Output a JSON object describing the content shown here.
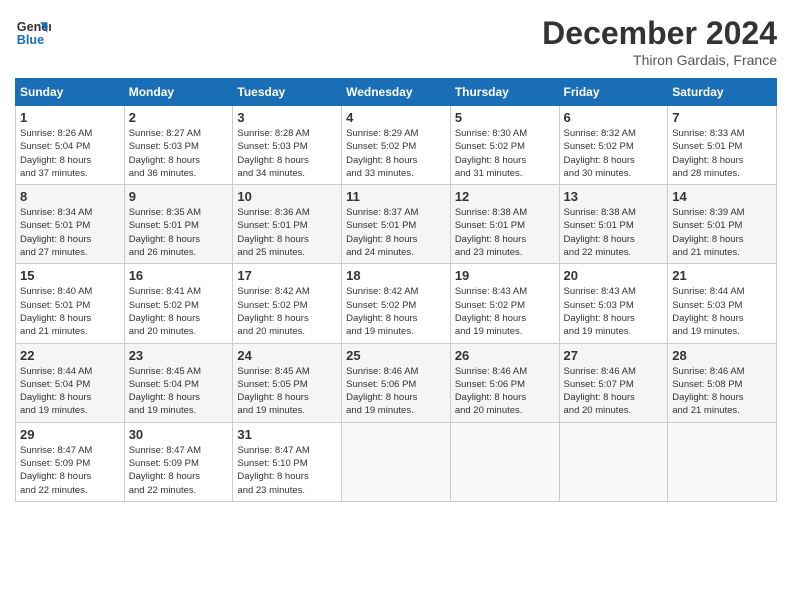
{
  "logo": {
    "line1": "General",
    "line2": "Blue"
  },
  "title": "December 2024",
  "subtitle": "Thiron Gardais, France",
  "days_of_week": [
    "Sunday",
    "Monday",
    "Tuesday",
    "Wednesday",
    "Thursday",
    "Friday",
    "Saturday"
  ],
  "weeks": [
    [
      {
        "num": "1",
        "info": "Sunrise: 8:26 AM\nSunset: 5:04 PM\nDaylight: 8 hours\nand 37 minutes."
      },
      {
        "num": "2",
        "info": "Sunrise: 8:27 AM\nSunset: 5:03 PM\nDaylight: 8 hours\nand 36 minutes."
      },
      {
        "num": "3",
        "info": "Sunrise: 8:28 AM\nSunset: 5:03 PM\nDaylight: 8 hours\nand 34 minutes."
      },
      {
        "num": "4",
        "info": "Sunrise: 8:29 AM\nSunset: 5:02 PM\nDaylight: 8 hours\nand 33 minutes."
      },
      {
        "num": "5",
        "info": "Sunrise: 8:30 AM\nSunset: 5:02 PM\nDaylight: 8 hours\nand 31 minutes."
      },
      {
        "num": "6",
        "info": "Sunrise: 8:32 AM\nSunset: 5:02 PM\nDaylight: 8 hours\nand 30 minutes."
      },
      {
        "num": "7",
        "info": "Sunrise: 8:33 AM\nSunset: 5:01 PM\nDaylight: 8 hours\nand 28 minutes."
      }
    ],
    [
      {
        "num": "8",
        "info": "Sunrise: 8:34 AM\nSunset: 5:01 PM\nDaylight: 8 hours\nand 27 minutes."
      },
      {
        "num": "9",
        "info": "Sunrise: 8:35 AM\nSunset: 5:01 PM\nDaylight: 8 hours\nand 26 minutes."
      },
      {
        "num": "10",
        "info": "Sunrise: 8:36 AM\nSunset: 5:01 PM\nDaylight: 8 hours\nand 25 minutes."
      },
      {
        "num": "11",
        "info": "Sunrise: 8:37 AM\nSunset: 5:01 PM\nDaylight: 8 hours\nand 24 minutes."
      },
      {
        "num": "12",
        "info": "Sunrise: 8:38 AM\nSunset: 5:01 PM\nDaylight: 8 hours\nand 23 minutes."
      },
      {
        "num": "13",
        "info": "Sunrise: 8:38 AM\nSunset: 5:01 PM\nDaylight: 8 hours\nand 22 minutes."
      },
      {
        "num": "14",
        "info": "Sunrise: 8:39 AM\nSunset: 5:01 PM\nDaylight: 8 hours\nand 21 minutes."
      }
    ],
    [
      {
        "num": "15",
        "info": "Sunrise: 8:40 AM\nSunset: 5:01 PM\nDaylight: 8 hours\nand 21 minutes."
      },
      {
        "num": "16",
        "info": "Sunrise: 8:41 AM\nSunset: 5:02 PM\nDaylight: 8 hours\nand 20 minutes."
      },
      {
        "num": "17",
        "info": "Sunrise: 8:42 AM\nSunset: 5:02 PM\nDaylight: 8 hours\nand 20 minutes."
      },
      {
        "num": "18",
        "info": "Sunrise: 8:42 AM\nSunset: 5:02 PM\nDaylight: 8 hours\nand 19 minutes."
      },
      {
        "num": "19",
        "info": "Sunrise: 8:43 AM\nSunset: 5:02 PM\nDaylight: 8 hours\nand 19 minutes."
      },
      {
        "num": "20",
        "info": "Sunrise: 8:43 AM\nSunset: 5:03 PM\nDaylight: 8 hours\nand 19 minutes."
      },
      {
        "num": "21",
        "info": "Sunrise: 8:44 AM\nSunset: 5:03 PM\nDaylight: 8 hours\nand 19 minutes."
      }
    ],
    [
      {
        "num": "22",
        "info": "Sunrise: 8:44 AM\nSunset: 5:04 PM\nDaylight: 8 hours\nand 19 minutes."
      },
      {
        "num": "23",
        "info": "Sunrise: 8:45 AM\nSunset: 5:04 PM\nDaylight: 8 hours\nand 19 minutes."
      },
      {
        "num": "24",
        "info": "Sunrise: 8:45 AM\nSunset: 5:05 PM\nDaylight: 8 hours\nand 19 minutes."
      },
      {
        "num": "25",
        "info": "Sunrise: 8:46 AM\nSunset: 5:06 PM\nDaylight: 8 hours\nand 19 minutes."
      },
      {
        "num": "26",
        "info": "Sunrise: 8:46 AM\nSunset: 5:06 PM\nDaylight: 8 hours\nand 20 minutes."
      },
      {
        "num": "27",
        "info": "Sunrise: 8:46 AM\nSunset: 5:07 PM\nDaylight: 8 hours\nand 20 minutes."
      },
      {
        "num": "28",
        "info": "Sunrise: 8:46 AM\nSunset: 5:08 PM\nDaylight: 8 hours\nand 21 minutes."
      }
    ],
    [
      {
        "num": "29",
        "info": "Sunrise: 8:47 AM\nSunset: 5:09 PM\nDaylight: 8 hours\nand 22 minutes."
      },
      {
        "num": "30",
        "info": "Sunrise: 8:47 AM\nSunset: 5:09 PM\nDaylight: 8 hours\nand 22 minutes."
      },
      {
        "num": "31",
        "info": "Sunrise: 8:47 AM\nSunset: 5:10 PM\nDaylight: 8 hours\nand 23 minutes."
      },
      null,
      null,
      null,
      null
    ]
  ]
}
